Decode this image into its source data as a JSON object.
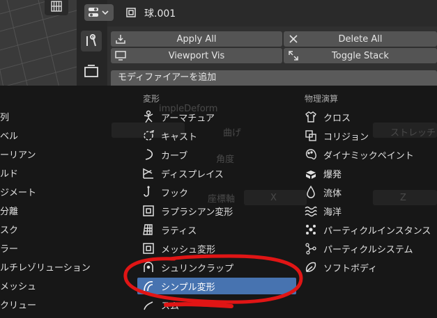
{
  "header": {
    "object_name": "球.001",
    "editor_type_icon": "properties-icon",
    "object_icon": "mesh-object-icon"
  },
  "toolbar": {
    "apply_all": "Apply All",
    "delete_all": "Delete All",
    "viewport_vis": "Viewport Vis",
    "toggle_stack": "Toggle Stack"
  },
  "add_modifier_label": "モディファイアーを追加",
  "menu": {
    "left_column": [
      "列",
      "ベル",
      "ーリアン",
      "ルド",
      "ジメート",
      "分離",
      "スク",
      "ラー",
      "ルチレゾリューション",
      "メッシュ",
      "クリュー"
    ],
    "deform": {
      "heading": "変形",
      "items": [
        {
          "label": "アーマチュア",
          "icon": "armature-icon"
        },
        {
          "label": "キャスト",
          "icon": "cast-icon"
        },
        {
          "label": "カーブ",
          "icon": "curve-icon"
        },
        {
          "label": "ディスプレイス",
          "icon": "displace-icon"
        },
        {
          "label": "フック",
          "icon": "hook-icon"
        },
        {
          "label": "ラプラシアン変形",
          "icon": "laplacian-icon"
        },
        {
          "label": "ラティス",
          "icon": "lattice-icon"
        },
        {
          "label": "メッシュ変形",
          "icon": "mesh-deform-icon"
        },
        {
          "label": "シュリンクラップ",
          "icon": "shrinkwrap-icon"
        },
        {
          "label": "シンプル変形",
          "icon": "simple-deform-icon",
          "selected": true
        },
        {
          "label": "スム",
          "icon": "smooth-icon"
        }
      ]
    },
    "physics": {
      "heading": "物理演算",
      "items": [
        {
          "label": "クロス",
          "icon": "cloth-icon"
        },
        {
          "label": "コリジョン",
          "icon": "collision-icon"
        },
        {
          "label": "ダイナミックペイント",
          "icon": "dynamic-paint-icon"
        },
        {
          "label": "爆発",
          "icon": "explode-icon"
        },
        {
          "label": "流体",
          "icon": "fluid-icon"
        },
        {
          "label": "海洋",
          "icon": "ocean-icon"
        },
        {
          "label": "パーティクルインスタンス",
          "icon": "particle-instance-icon"
        },
        {
          "label": "パーティクルシステム",
          "icon": "particle-system-icon"
        },
        {
          "label": "ソフトボディ",
          "icon": "soft-body-icon"
        }
      ]
    }
  },
  "background_panel": {
    "modifier_name": "impleDeform",
    "twist": "曲げ",
    "stretch": "ストレッチ",
    "angle": "角度",
    "axis": "座標軸",
    "x": "X",
    "z": "Z"
  },
  "colors": {
    "selected": "#4773b0",
    "annotation": "#e01515",
    "menu_bg": "#171717"
  }
}
